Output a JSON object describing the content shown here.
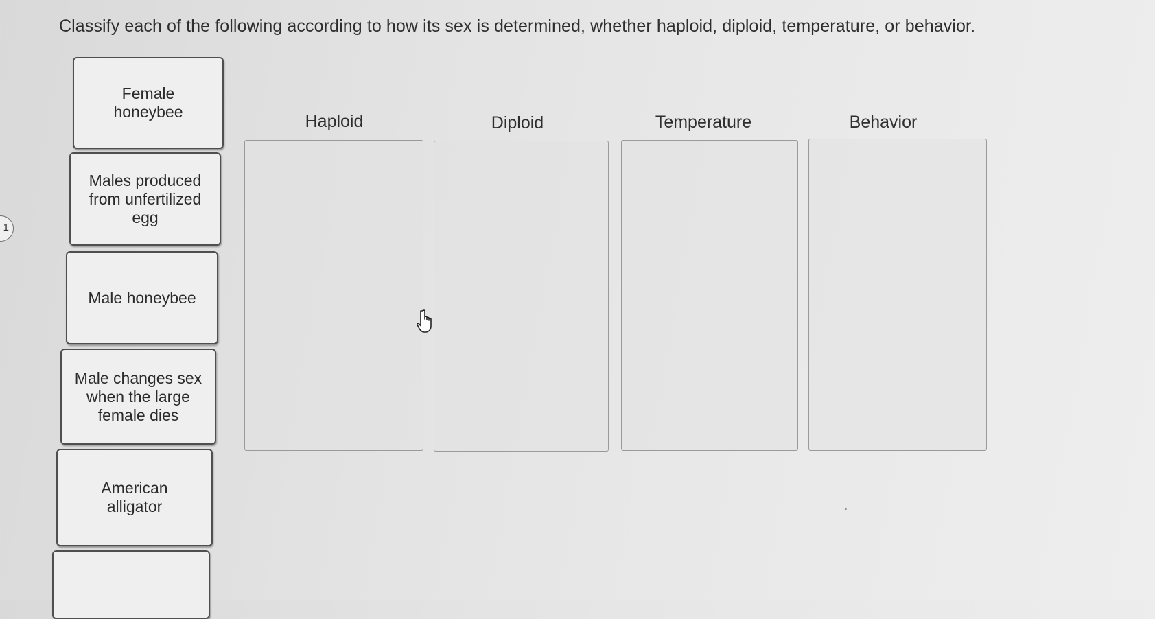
{
  "prompt": "Classify each of the following according to how its sex is determined, whether haploid, diploid, temperature, or behavior.",
  "side_badge": "1",
  "cards": [
    {
      "label": "Female honeybee"
    },
    {
      "label": "Males produced from unfertilized egg"
    },
    {
      "label": "Male honeybee"
    },
    {
      "label": "Male changes sex when the large female dies"
    },
    {
      "label": "American alligator"
    },
    {
      "label": ""
    }
  ],
  "categories": [
    {
      "label": "Haploid"
    },
    {
      "label": "Diploid"
    },
    {
      "label": "Temperature"
    },
    {
      "label": "Behavior"
    }
  ],
  "cursor_icon": "hand-pointer-icon"
}
